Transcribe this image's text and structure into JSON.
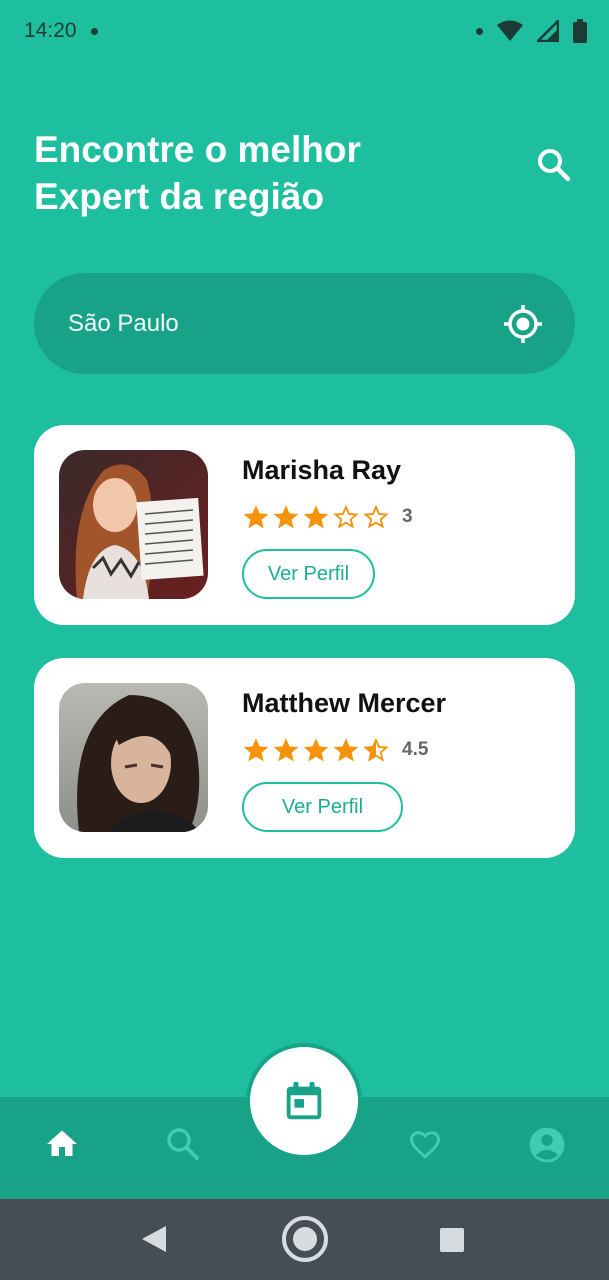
{
  "status_bar": {
    "time": "14:20"
  },
  "header": {
    "title_line1": "Encontre o melhor",
    "title_line2": "Expert da região"
  },
  "location": {
    "value": "São Paulo"
  },
  "experts": [
    {
      "name": "Marisha Ray",
      "rating": 3,
      "rating_label": "3",
      "button": "Ver Perfil"
    },
    {
      "name": "Matthew Mercer",
      "rating": 4.5,
      "rating_label": "4.5",
      "button": "Ver Perfil"
    }
  ],
  "colors": {
    "primary": "#1dbf9e",
    "primary_dark": "#18a288",
    "star": "#f5940b",
    "system_nav": "#454d55"
  },
  "icons": {
    "header_search": "search-icon",
    "location": "gps-target-icon",
    "nav_home": "home-icon",
    "nav_search": "search-icon",
    "nav_calendar": "calendar-icon",
    "nav_favorites": "heart-icon",
    "nav_profile": "account-icon"
  }
}
